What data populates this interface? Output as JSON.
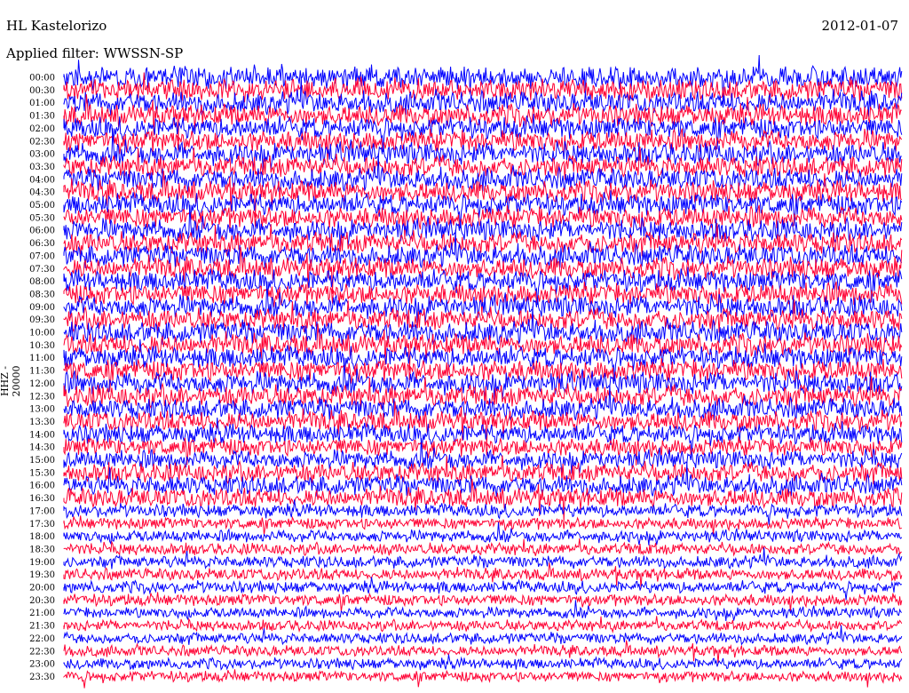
{
  "header": {
    "station": "HL Kastelorizo",
    "date": "2012-01-07",
    "filter": "Applied filter: WWSSN-SP",
    "channel": "HHZ - 20000"
  },
  "chart_data": {
    "type": "line",
    "title": "HL Kastelorizo",
    "subtitle": "Applied filter: WWSSN-SP",
    "ylabel": "HHZ - 20000",
    "row_labels": [
      "00:00",
      "00:30",
      "01:00",
      "01:30",
      "02:00",
      "02:30",
      "03:00",
      "03:30",
      "04:00",
      "04:30",
      "05:00",
      "05:30",
      "06:00",
      "06:30",
      "07:00",
      "07:30",
      "08:00",
      "08:30",
      "09:00",
      "09:30",
      "10:00",
      "10:30",
      "11:00",
      "11:30",
      "12:00",
      "12:30",
      "13:00",
      "13:30",
      "14:00",
      "14:30",
      "15:00",
      "15:30",
      "16:00",
      "16:30",
      "17:00",
      "17:30",
      "18:00",
      "18:30",
      "19:00",
      "19:30",
      "20:00",
      "20:30",
      "21:00",
      "21:30",
      "22:00",
      "22:30",
      "23:00",
      "23:30"
    ],
    "colors": [
      "#0000ff",
      "#ff0033"
    ],
    "trace_amplitude_relative": [
      1.0,
      1.0,
      1.0,
      1.0,
      1.0,
      1.0,
      1.0,
      1.0,
      1.0,
      1.0,
      1.0,
      1.0,
      1.0,
      1.0,
      1.0,
      1.0,
      1.0,
      1.0,
      1.0,
      1.0,
      1.0,
      1.0,
      1.0,
      1.0,
      1.0,
      1.0,
      0.95,
      0.95,
      0.9,
      0.85,
      0.85,
      0.9,
      0.9,
      0.9,
      0.6,
      0.55,
      0.55,
      0.55,
      0.55,
      0.55,
      0.55,
      0.55,
      0.5,
      0.5,
      0.5,
      0.5,
      0.5,
      0.5
    ],
    "grid": false
  }
}
